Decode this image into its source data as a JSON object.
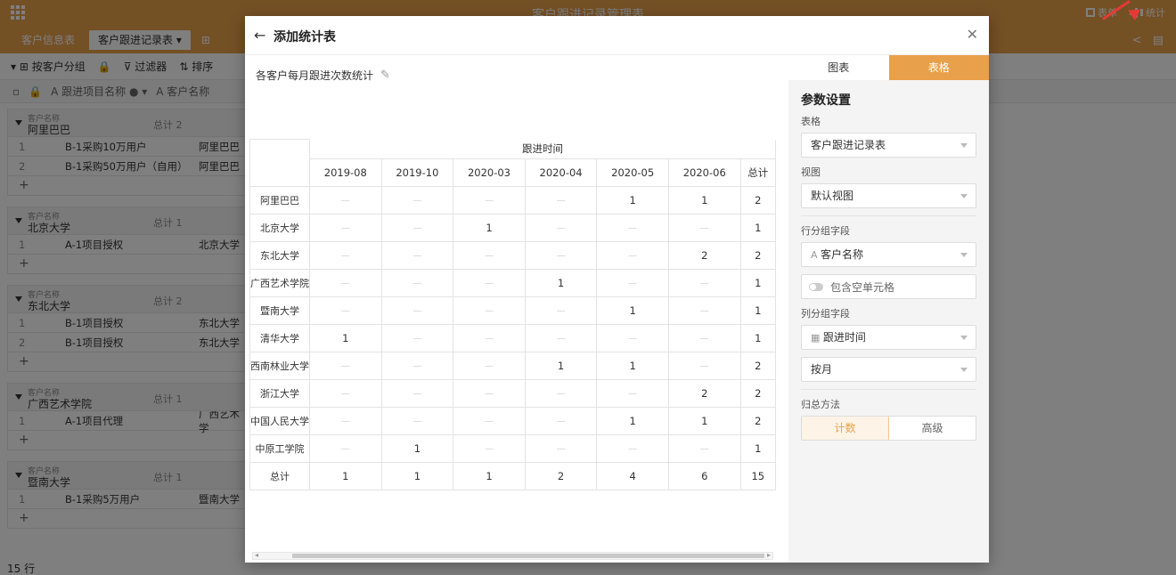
{
  "app": {
    "title": "客户跟进记录管理表",
    "top_right": {
      "form_label": "表单",
      "stats_label": "统计"
    },
    "tabs": [
      "客户信息表",
      "客户跟进记录表"
    ],
    "toolbar": [
      "按客户分组",
      "过滤器",
      "排序"
    ],
    "column_headers": [
      "跟进项目名称",
      "客户名称"
    ],
    "groups": [
      {
        "label": "客户名称",
        "name": "阿里巴巴",
        "total": "总计 2",
        "rows": [
          {
            "n": "1",
            "project": "B-1采购10万用户",
            "client": "阿里巴巴"
          },
          {
            "n": "2",
            "project": "B-1采购50万用户（自用）",
            "client": "阿里巴巴"
          }
        ]
      },
      {
        "label": "客户名称",
        "name": "北京大学",
        "total": "总计 1",
        "rows": [
          {
            "n": "1",
            "project": "A-1项目授权",
            "client": "北京大学"
          }
        ]
      },
      {
        "label": "客户名称",
        "name": "东北大学",
        "total": "总计 2",
        "rows": [
          {
            "n": "1",
            "project": "B-1项目授权",
            "client": "东北大学"
          },
          {
            "n": "2",
            "project": "B-1项目授权",
            "client": "东北大学"
          }
        ]
      },
      {
        "label": "客户名称",
        "name": "广西艺术学院",
        "total": "总计 1",
        "rows": [
          {
            "n": "1",
            "project": "A-1项目代理",
            "client": "广西艺术学"
          }
        ]
      },
      {
        "label": "客户名称",
        "name": "暨南大学",
        "total": "总计 1",
        "rows": [
          {
            "n": "1",
            "project": "B-1采购5万用户",
            "client": "暨南大学"
          }
        ]
      }
    ],
    "status": "15 行"
  },
  "modal": {
    "title": "添加统计表",
    "chart_name": "各客户每月跟进次数统计",
    "pivot": {
      "group_header": "跟进时间",
      "columns": [
        "2019-08",
        "2019-10",
        "2020-03",
        "2020-04",
        "2020-05",
        "2020-06",
        "总计"
      ],
      "rows": [
        {
          "name": "阿里巴巴",
          "values": [
            "—",
            "—",
            "—",
            "—",
            "1",
            "1",
            "2"
          ]
        },
        {
          "name": "北京大学",
          "values": [
            "—",
            "—",
            "1",
            "—",
            "—",
            "—",
            "1"
          ]
        },
        {
          "name": "东北大学",
          "values": [
            "—",
            "—",
            "—",
            "—",
            "—",
            "2",
            "2"
          ]
        },
        {
          "name": "广西艺术学院",
          "values": [
            "—",
            "—",
            "—",
            "1",
            "—",
            "—",
            "1"
          ]
        },
        {
          "name": "暨南大学",
          "values": [
            "—",
            "—",
            "—",
            "—",
            "1",
            "—",
            "1"
          ]
        },
        {
          "name": "清华大学",
          "values": [
            "1",
            "—",
            "—",
            "—",
            "—",
            "—",
            "1"
          ]
        },
        {
          "name": "西南林业大学",
          "values": [
            "—",
            "—",
            "—",
            "1",
            "1",
            "—",
            "2"
          ]
        },
        {
          "name": "浙江大学",
          "values": [
            "—",
            "—",
            "—",
            "—",
            "—",
            "2",
            "2"
          ]
        },
        {
          "name": "中国人民大学",
          "values": [
            "—",
            "—",
            "—",
            "—",
            "1",
            "1",
            "2"
          ]
        },
        {
          "name": "中原工学院",
          "values": [
            "—",
            "1",
            "—",
            "—",
            "—",
            "—",
            "1"
          ]
        },
        {
          "name": "总计",
          "values": [
            "1",
            "1",
            "1",
            "2",
            "4",
            "6",
            "15"
          ]
        }
      ]
    },
    "panel": {
      "tabs": [
        "图表",
        "表格"
      ],
      "active_tab": 1,
      "section_title": "参数设置",
      "table_label": "表格",
      "table_value": "客户跟进记录表",
      "view_label": "视图",
      "view_value": "默认视图",
      "row_group_label": "行分组字段",
      "row_group_value": "客户名称",
      "include_empty": "包含空单元格",
      "col_group_label": "列分组字段",
      "col_group_value": "跟进时间",
      "granularity": "按月",
      "agg_label": "归总方法",
      "agg_options": [
        "计数",
        "高级"
      ]
    },
    "accent_color": "#e9a04a"
  }
}
